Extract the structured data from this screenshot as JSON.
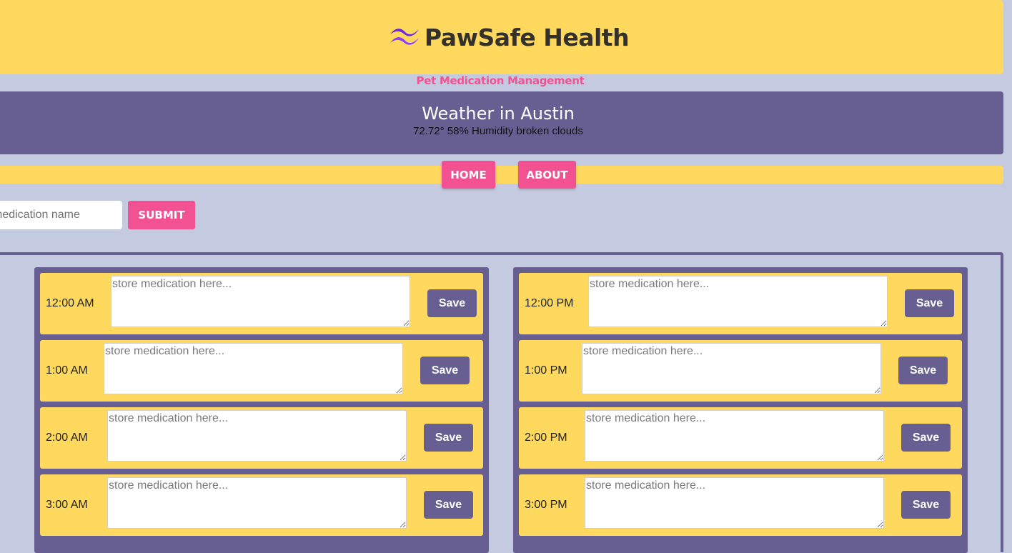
{
  "header": {
    "title": "PawSafe Health",
    "logo_icon": "wave-logo-icon",
    "subtitle": "Pet Medication Management"
  },
  "weather": {
    "title": "Weather in Austin",
    "details": "72.72° 58% Humidity broken clouds"
  },
  "nav": {
    "home_label": "HOME",
    "about_label": "ABOUT"
  },
  "form": {
    "placeholder": "medication name",
    "submit_label": "SUBMIT"
  },
  "schedule": {
    "am": [
      {
        "time": "12:00 AM",
        "placeholder": "store medication here...",
        "save_label": "Save"
      },
      {
        "time": "1:00 AM",
        "placeholder": "store medication here...",
        "save_label": "Save"
      },
      {
        "time": "2:00 AM",
        "placeholder": "store medication here...",
        "save_label": "Save"
      },
      {
        "time": "3:00 AM",
        "placeholder": "store medication here...",
        "save_label": "Save"
      }
    ],
    "pm": [
      {
        "time": "12:00 PM",
        "placeholder": "store medication here...",
        "save_label": "Save"
      },
      {
        "time": "1:00 PM",
        "placeholder": "store medication here...",
        "save_label": "Save"
      },
      {
        "time": "2:00 PM",
        "placeholder": "store medication here...",
        "save_label": "Save"
      },
      {
        "time": "3:00 PM",
        "placeholder": "store medication here...",
        "save_label": "Save"
      }
    ]
  },
  "colors": {
    "background": "#c4cadf",
    "yellow": "#ffd95d",
    "purple": "#675f92",
    "pink": "#f25291",
    "logo_purple": "#7b2ff7"
  }
}
